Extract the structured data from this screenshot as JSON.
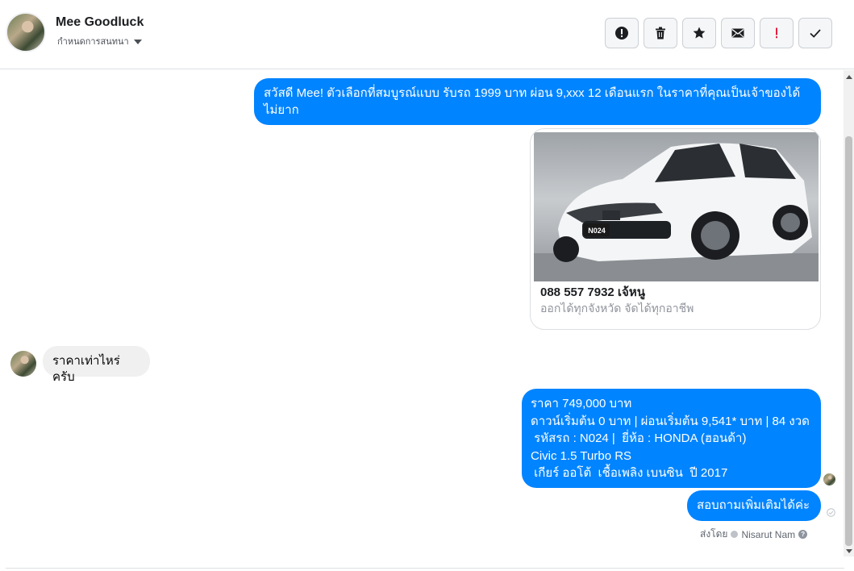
{
  "header": {
    "contact_name": "Mee Goodluck",
    "assign_label": "กำหนดการสนทนา",
    "toolbar": [
      {
        "name": "spam-report-button",
        "icon": "exclamation-circle-icon"
      },
      {
        "name": "delete-button",
        "icon": "trash-icon"
      },
      {
        "name": "star-button",
        "icon": "star-icon"
      },
      {
        "name": "mark-unread-button",
        "icon": "envelope-icon"
      },
      {
        "name": "mark-important-button",
        "icon": "exclamation-icon"
      },
      {
        "name": "mark-done-button",
        "icon": "check-icon"
      }
    ]
  },
  "messages": {
    "greeting": "สวัสดี Mee! ตัวเลือกที่สมบูรณ์แบบ รับรถ 1999 บาท ผ่อน 9,xxx 12 เดือนแรก ในราคาที่คุณเป็นเจ้าของได้ไม่ยาก",
    "card": {
      "plate": "N024",
      "title": "088 557 7932 เจ้หนู",
      "subtitle": "ออกได้ทุกจังหวัด จัดได้ทุกอาชีพ"
    },
    "incoming_question": "ราคาเท่าไหร่ครับ",
    "price_lines": [
      "ราคา 749,000 บาท",
      "ดาวน์เริ่มต้น 0 บาท | ผ่อนเริ่มต้น 9,541* บาท | 84 งวด",
      " รหัสรถ : N024 |  ยี่ห้อ : HONDA (ฮอนด้า)",
      "Civic 1.5 Turbo RS",
      " เกียร์ ออโต้  เชื้อเพลิง เบนซิน  ปี 2017"
    ],
    "followup": "สอบถามเพิ่มเติมได้ค่ะ",
    "sent_by_prefix": "ส่งโดย",
    "sent_by_name": "Nisarut Nam"
  },
  "colors": {
    "outgoing_bubble": "#0084ff",
    "incoming_bubble": "#f0f0f0",
    "important_icon": "#e41e3f"
  }
}
